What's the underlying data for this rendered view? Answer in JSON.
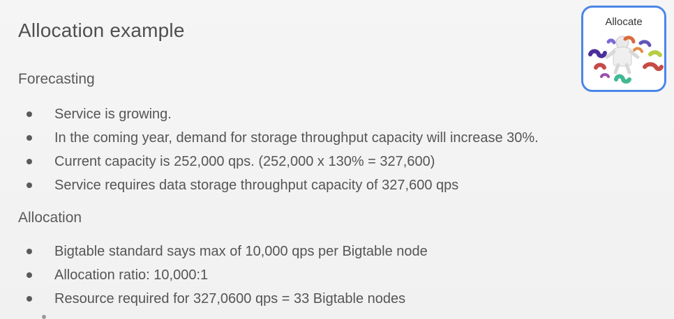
{
  "slide": {
    "title": "Allocation example",
    "sections": [
      {
        "heading": "Forecasting",
        "bullets": [
          "Service is growing.",
          "In the coming year, demand for storage throughput capacity will increase 30%.",
          "Current capacity is 252,000 qps.  (252,000 x 130% = 327,600)",
          "Service requires data storage throughput capacity of 327,600 qps"
        ]
      },
      {
        "heading": "Allocation",
        "bullets": [
          "Bigtable standard says max of 10,000 qps per Bigtable node",
          "Allocation ratio: 10,000:1",
          "Resource required for 327,0600 qps = 33 Bigtable nodes"
        ]
      }
    ]
  },
  "badge": {
    "label": "Allocate",
    "icon": "person-with-puzzle-pieces-icon",
    "border_color": "#4a86e8"
  }
}
